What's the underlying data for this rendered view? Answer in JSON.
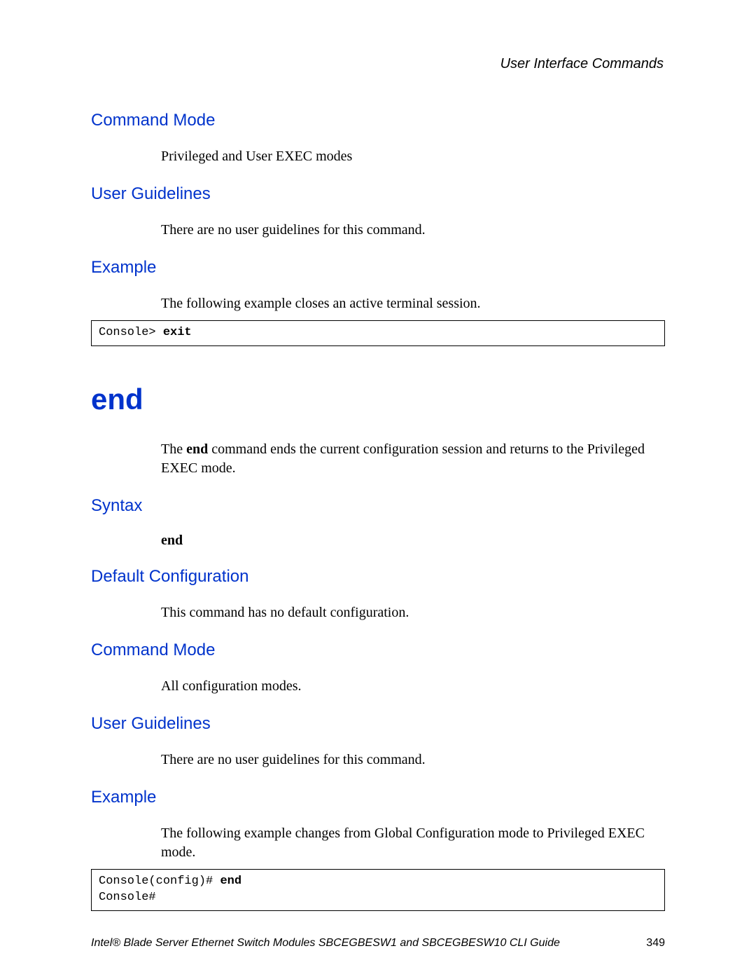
{
  "chapter": "User Interface Commands",
  "sections": {
    "command_mode_1": {
      "heading": "Command Mode",
      "body": "Privileged and User EXEC modes"
    },
    "user_guidelines_1": {
      "heading": "User Guidelines",
      "body": "There are no user guidelines for this command."
    },
    "example_1": {
      "heading": "Example",
      "body": "The following example closes an active terminal session.",
      "code_prefix": "Console> ",
      "code_bold": "exit"
    },
    "end_title": "end",
    "end_intro_pre": "The ",
    "end_intro_bold": "end",
    "end_intro_post": " command ends the current configuration session and returns to the Privileged EXEC mode.",
    "syntax": {
      "heading": "Syntax",
      "body": "end"
    },
    "default_config": {
      "heading": "Default Configuration",
      "body": "This command has no default configuration."
    },
    "command_mode_2": {
      "heading": "Command Mode",
      "body": "All configuration modes."
    },
    "user_guidelines_2": {
      "heading": "User Guidelines",
      "body": "There are no user guidelines for this command."
    },
    "example_2": {
      "heading": "Example",
      "body": "The following example changes from Global Configuration mode to Privileged EXEC mode.",
      "code_line1_prefix": "Console(config)# ",
      "code_line1_bold": "end",
      "code_line2": "Console#"
    }
  },
  "footer": {
    "title": "Intel® Blade Server Ethernet Switch Modules SBCEGBESW1 and SBCEGBESW10 CLI Guide",
    "page": "349"
  }
}
